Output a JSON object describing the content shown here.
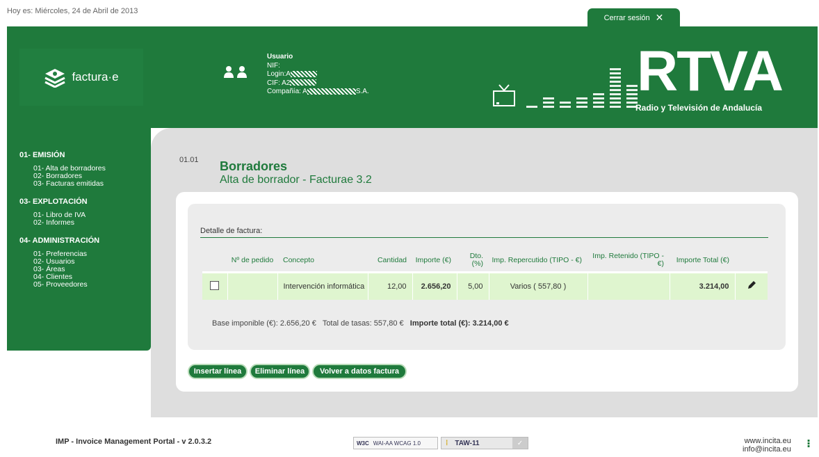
{
  "top": {
    "date": "Hoy es: Miércoles, 24 de Abril de 2013",
    "logout_label": "Cerrar sesión",
    "logout_icon": "✕"
  },
  "header": {
    "logo_text": "factura·e",
    "user_title": "Usuario",
    "nif_label": "NIF:",
    "login_label": "Login:A",
    "cif_label": "CIF: A2",
    "company_label": "Compañía: A",
    "company_suffix": "S.A.",
    "brand": "RTVA",
    "brand_sub": "Radio y Televisión de Andalucía"
  },
  "sidebar": {
    "sections": [
      {
        "title": "01- EMISIÓN",
        "items": [
          "01- Alta de borradores",
          "02- Borradores",
          "03- Facturas emitidas"
        ]
      },
      {
        "title": "03- EXPLOTACIÓN",
        "items": [
          "01- Libro de IVA",
          "02- Informes"
        ]
      },
      {
        "title": "04- ADMINISTRACIÓN",
        "items": [
          "01- Preferencias",
          "02- Usuarios",
          "03- Áreas",
          "04- Clientes",
          "05- Proveedores"
        ]
      }
    ]
  },
  "page": {
    "code": "01.01",
    "title": "Borradores",
    "subtitle": "Alta de borrador - Facturae 3.2"
  },
  "detail": {
    "label": "Detalle de factura:",
    "headers": [
      "",
      "Nº de pedido",
      "Concepto",
      "Cantidad",
      "Importe (€)",
      "Dto. (%)",
      "Imp. Repercutido (TIPO - €)",
      "Imp. Retenido (TIPO - €)",
      "Importe Total (€)",
      ""
    ],
    "row": {
      "pedido": "",
      "concepto": "Intervención informática",
      "cantidad": "12,00",
      "importe": "2.656,20",
      "dto": "5,00",
      "repercutido": "Varios ( 557,80 )",
      "retenido": "",
      "total": "3.214,00"
    },
    "totals": {
      "base": "Base imponible (€): 2.656,20 €",
      "tasas": "Total de tasas: 557,80 €",
      "total": "Importe total (€): 3.214,00 €"
    }
  },
  "buttons": {
    "insert": "Insertar línea",
    "delete": "Eliminar línea",
    "back": "Volver a datos factura"
  },
  "footer": {
    "portal": "IMP - Invoice Management Portal - v 2.0.3.2",
    "w3c": "W3C",
    "wai": "WAI-AA WCAG 1.0",
    "taw": "TAW-11",
    "web": "www.incita.eu",
    "email": "info@incita.eu"
  },
  "colors": {
    "primary": "#1f7a3c",
    "row_bg": "#dff5cf",
    "content_bg": "#dedede"
  }
}
